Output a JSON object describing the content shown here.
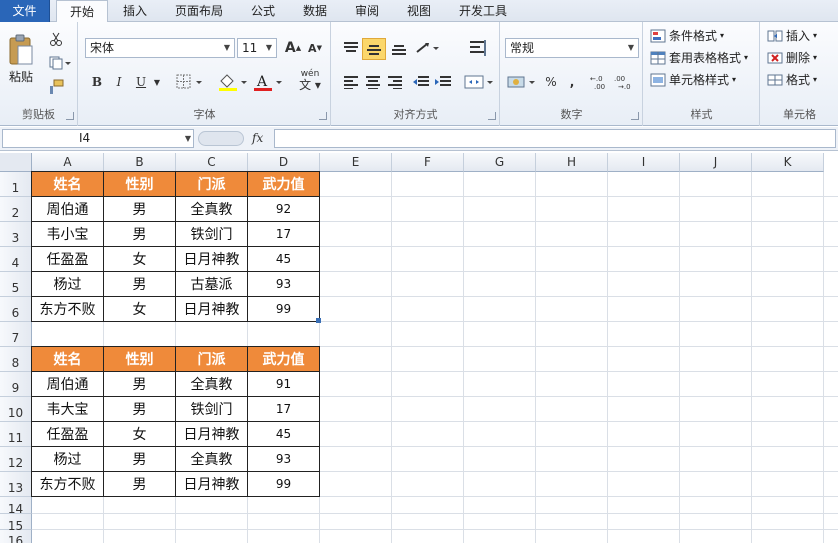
{
  "tabs": [
    {
      "label": "文件"
    },
    {
      "label": "开始"
    },
    {
      "label": "插入"
    },
    {
      "label": "页面布局"
    },
    {
      "label": "公式"
    },
    {
      "label": "数据"
    },
    {
      "label": "审阅"
    },
    {
      "label": "视图"
    },
    {
      "label": "开发工具"
    }
  ],
  "ribbon": {
    "clipboard": {
      "label": "剪贴板",
      "paste": "粘贴"
    },
    "font": {
      "label": "字体",
      "name": "宋体",
      "size": "11",
      "bold": "B",
      "italic": "I",
      "underline": "U",
      "grow": "A",
      "shrink": "A",
      "color_letter": "A",
      "wen": "wén"
    },
    "alignment": {
      "label": "对齐方式"
    },
    "number": {
      "label": "数字",
      "format": "常规",
      "percent": "%",
      "comma": ","
    },
    "styles": {
      "label": "样式",
      "conditional": "条件格式",
      "table_format": "套用表格格式",
      "cell_styles": "单元格样式"
    },
    "cells": {
      "label": "单元格",
      "insert": "插入",
      "delete": "删除",
      "format": "格式"
    }
  },
  "formula_bar": {
    "name_box": "I4",
    "fx": "fx",
    "value": ""
  },
  "columns": [
    "A",
    "B",
    "C",
    "D",
    "E",
    "F",
    "G",
    "H",
    "I",
    "J",
    "K"
  ],
  "rows": [
    "1",
    "2",
    "3",
    "4",
    "5",
    "6",
    "7",
    "8",
    "9",
    "10",
    "11",
    "12",
    "13",
    "14",
    "15",
    "16"
  ],
  "table1": {
    "headers": [
      "姓名",
      "性别",
      "门派",
      "武力值"
    ],
    "rows": [
      [
        "周伯通",
        "男",
        "全真教",
        "92"
      ],
      [
        "韦小宝",
        "男",
        "铁剑门",
        "17"
      ],
      [
        "任盈盈",
        "女",
        "日月神教",
        "45"
      ],
      [
        "杨过",
        "男",
        "古墓派",
        "93"
      ],
      [
        "东方不败",
        "女",
        "日月神教",
        "99"
      ]
    ]
  },
  "table2": {
    "headers": [
      "姓名",
      "性别",
      "门派",
      "武力值"
    ],
    "rows": [
      [
        "周伯通",
        "男",
        "全真教",
        "91"
      ],
      [
        "韦大宝",
        "男",
        "铁剑门",
        "17"
      ],
      [
        "任盈盈",
        "女",
        "日月神教",
        "45"
      ],
      [
        "杨过",
        "男",
        "全真教",
        "93"
      ],
      [
        "东方不败",
        "男",
        "日月神教",
        "99"
      ]
    ]
  },
  "colors": {
    "header_fill": "#ef8a3a",
    "file_tab": "#2a66b8"
  }
}
